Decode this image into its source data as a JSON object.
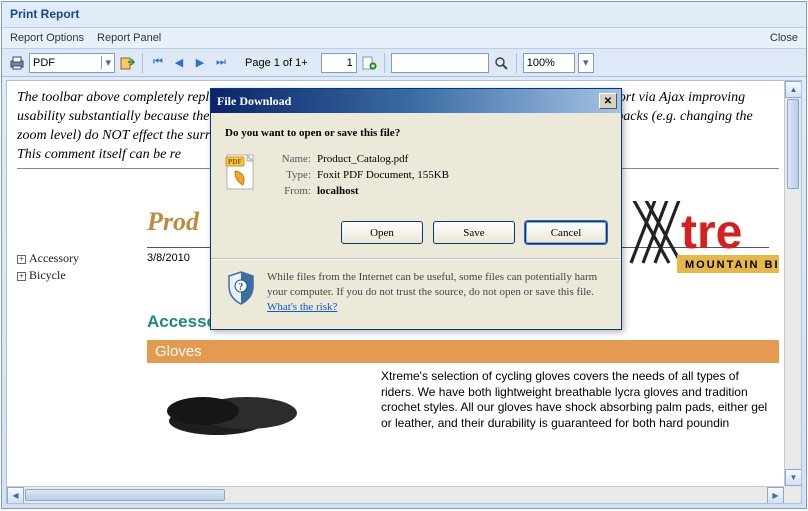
{
  "window": {
    "title": "Print Report"
  },
  "menubar": {
    "report_options": "Report Options",
    "report_panel": "Report Panel",
    "close": "Close"
  },
  "toolbar": {
    "format_select": "PDF",
    "page_label": "Page 1 of 1+",
    "page_input": "1",
    "search_input": "",
    "zoom_select": "100%"
  },
  "body_text": {
    "p1": "The toolbar above completely replaces the default toolbar. It performs the most common actions on the Report via Ajax improving usability substantially because the Report Viewer control itself cannot be Ajaxed. However, even those postbacks (e.g. changing the zoom level) do NOT effect the surrounding this window, or the rest of the page.",
    "p2": "This comment itself can be re"
  },
  "tree": {
    "items": [
      {
        "label": "Accessory"
      },
      {
        "label": "Bicycle"
      }
    ]
  },
  "report": {
    "title_partial": "Prod",
    "date": "3/8/2010",
    "logo_text_top": "tre",
    "logo_text_sub": "MOUNTAIN  BI",
    "section": "Accessories",
    "band": "Gloves",
    "desc": "Xtreme's selection of cycling gloves covers the needs of all types of riders.  We have both lightweight  breathable lycra gloves and tradition crochet styles.  All our gloves have shock absorbing palm pads, either gel or leather, and their durability is guaranteed for both hard poundin"
  },
  "dialog": {
    "title": "File Download",
    "question": "Do you want to open or save this file?",
    "name_label": "Name:",
    "name_value": "Product_Catalog.pdf",
    "type_label": "Type:",
    "type_value": "Foxit PDF Document, 155KB",
    "from_label": "From:",
    "from_value": "localhost",
    "btn_open": "Open",
    "btn_save": "Save",
    "btn_cancel": "Cancel",
    "footer_text": "While files from the Internet can be useful, some files can potentially harm your computer. If you do not trust the source, do not open or save this file. ",
    "footer_link": "What's the risk?"
  }
}
